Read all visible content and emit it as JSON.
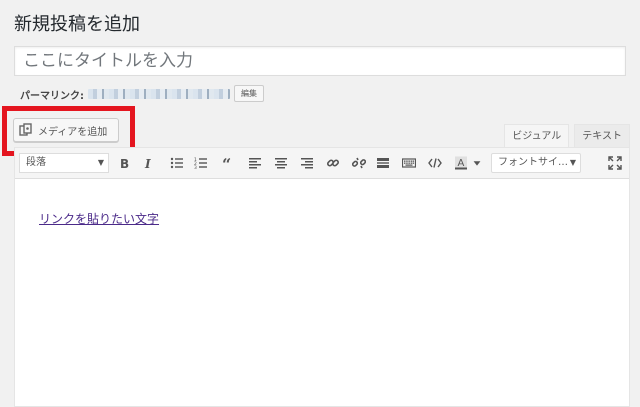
{
  "page": {
    "title": "新規投稿を追加"
  },
  "title_field": {
    "placeholder": "ここにタイトルを入力",
    "value": ""
  },
  "permalink": {
    "label": "パーマリンク:",
    "edit_label": "編集"
  },
  "media": {
    "add_label": "メディアを追加"
  },
  "editor_tabs": [
    {
      "label": "ビジュアル",
      "active": true
    },
    {
      "label": "テキスト",
      "active": false
    }
  ],
  "toolbar": {
    "format_selected": "段落",
    "font_size_selected": "フォントサイ…",
    "buttons": [
      "bold-icon",
      "italic-icon",
      "bullet-list-icon",
      "numbered-list-icon",
      "blockquote-icon",
      "align-left-icon",
      "align-center-icon",
      "align-right-icon",
      "link-icon",
      "unlink-icon",
      "read-more-icon",
      "keyboard-icon",
      "code-icon",
      "text-color-icon",
      "fullscreen-icon"
    ]
  },
  "content": {
    "link_text": "リンクを貼りたい文字"
  },
  "colors": {
    "highlight": "#e4151f",
    "link": "#4b2a89",
    "background": "#f1f1f1"
  }
}
